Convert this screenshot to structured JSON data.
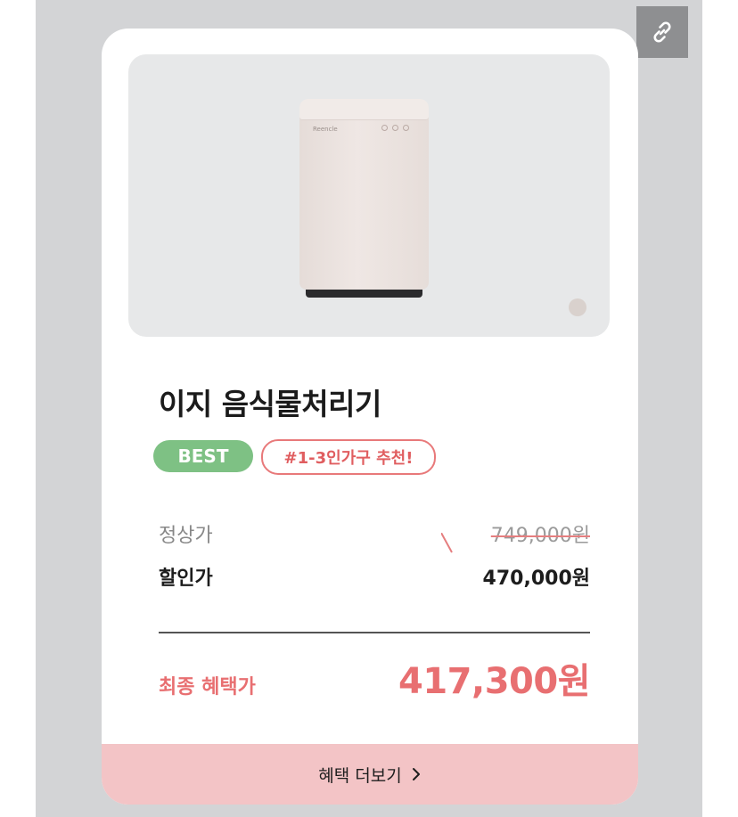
{
  "icons": {
    "share": "link-icon",
    "more_arrow": "chevron-right-icon"
  },
  "colors": {
    "accent": "#e86f71",
    "best_badge": "#7ec184",
    "button_bg": "#f3c4c6",
    "image_bg": "#e7e8e9"
  },
  "product": {
    "brand": "Reencle",
    "name": "이지 음식물처리기",
    "badges": {
      "best": "BEST",
      "recommend": "#1-3인가구 추천!"
    }
  },
  "prices": {
    "regular_label": "정상가",
    "regular_value": "749,000원",
    "sale_label": "할인가",
    "sale_value": "470,000원",
    "final_label": "최종 혜택가",
    "final_value": "417,300원"
  },
  "actions": {
    "more_label": "혜택 더보기"
  }
}
